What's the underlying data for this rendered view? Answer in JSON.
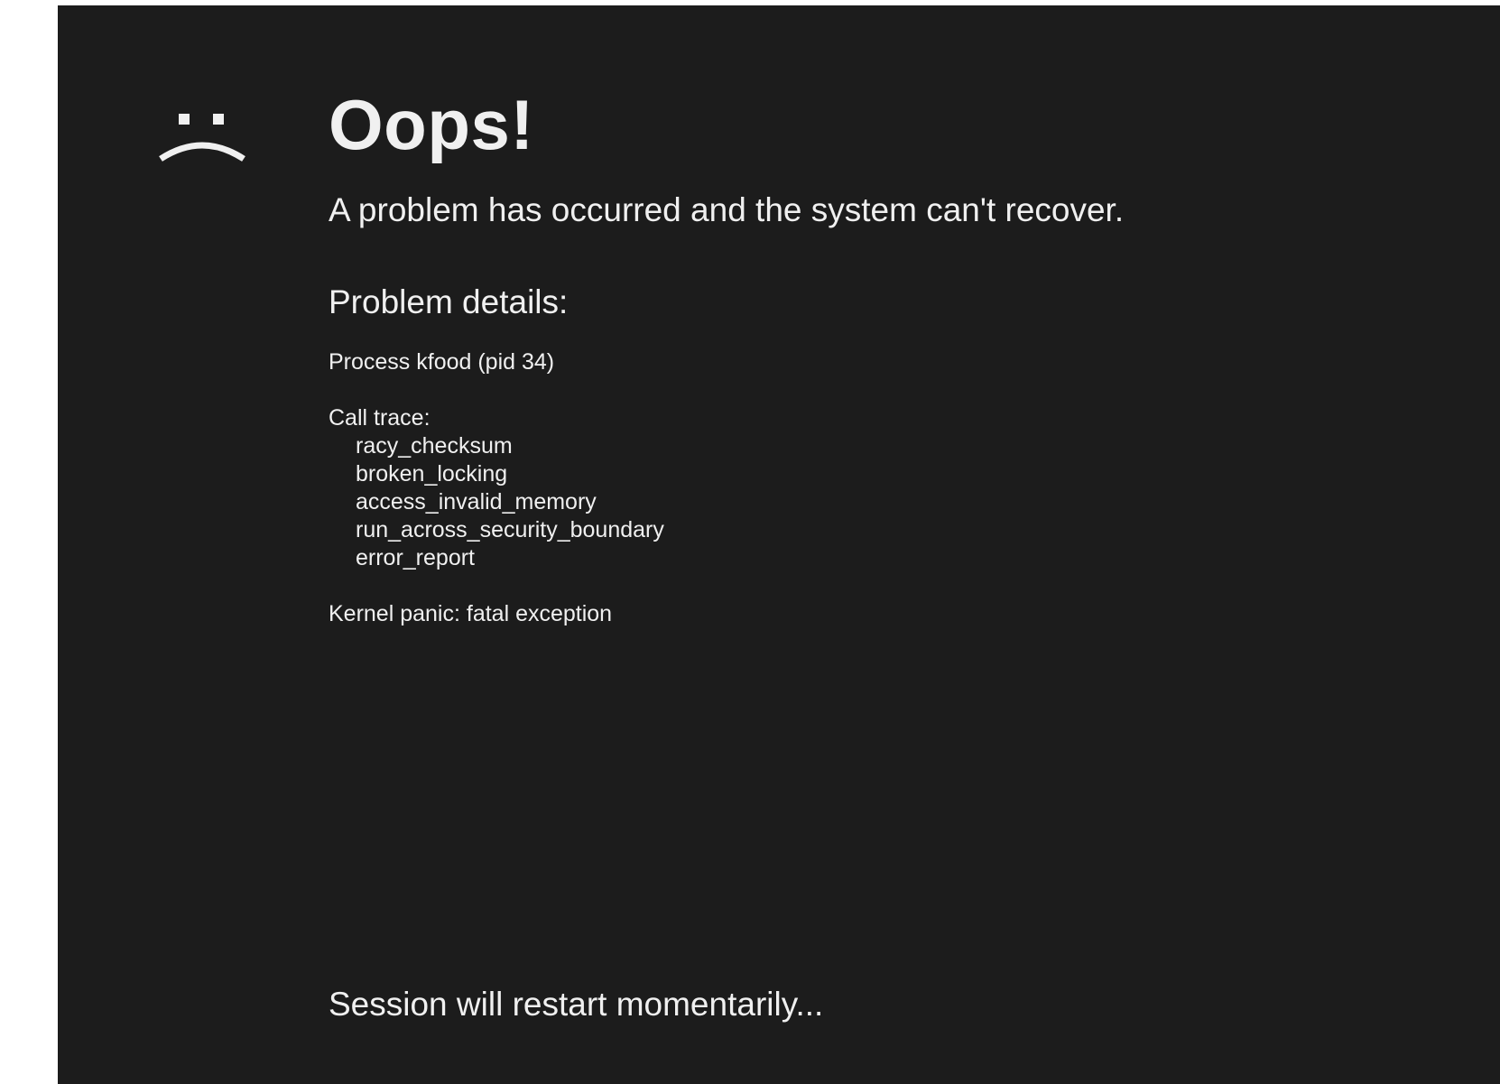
{
  "screen": {
    "background_color": "#1c1c1c",
    "text_color": "#f0f0f0",
    "icon": "sad-face-icon",
    "title": "Oops!",
    "subtitle": "A problem has occurred and the system can't recover.",
    "details_heading": "Problem details:",
    "process_line": "Process kfood (pid 34)",
    "call_trace_label": "Call trace:",
    "call_trace": [
      "racy_checksum",
      "broken_locking",
      "access_invalid_memory",
      "run_across_security_boundary",
      "error_report"
    ],
    "panic_line": "Kernel panic: fatal exception",
    "restart_message": "Session will restart momentarily..."
  }
}
